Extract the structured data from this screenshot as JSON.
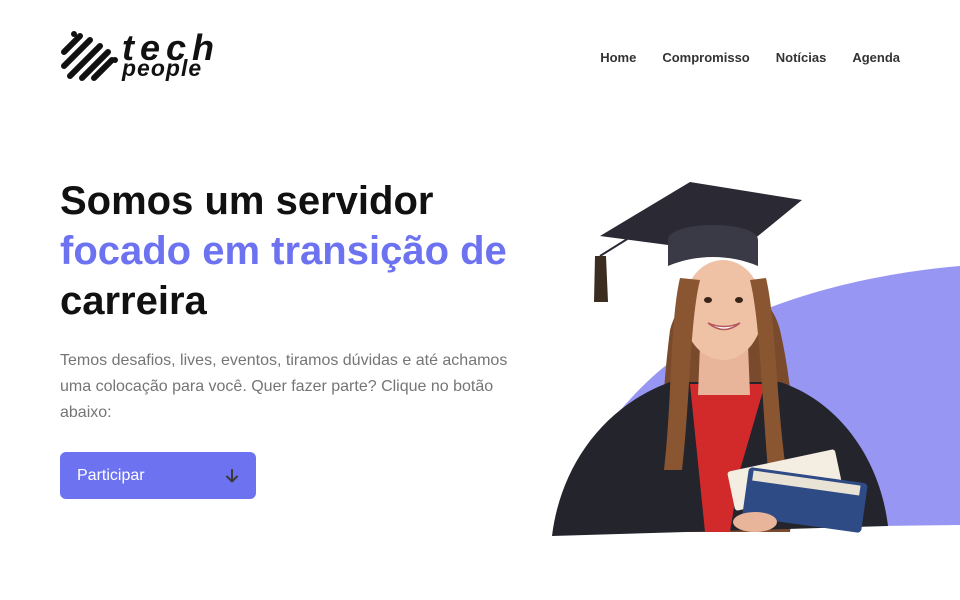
{
  "brand": {
    "word_top": "tech",
    "word_bottom": "people"
  },
  "nav": {
    "items": [
      {
        "label": "Home"
      },
      {
        "label": "Compromisso"
      },
      {
        "label": "Notícias"
      },
      {
        "label": "Agenda"
      }
    ]
  },
  "hero": {
    "headline_line1": "Somos um servidor",
    "headline_line2": "focado em transição de",
    "headline_line3": "carreira",
    "subtext": "Temos desafios, lives, eventos, tiramos dúvidas e até achamos uma colocação para você. Quer fazer parte? Clique no botão abaixo:",
    "cta_label": "Participar",
    "cta_icon": "arrow-down-icon"
  },
  "colors": {
    "accent": "#6c72f0",
    "blob": "#9896f3",
    "text_dark": "#111111",
    "text_muted": "#757575"
  }
}
